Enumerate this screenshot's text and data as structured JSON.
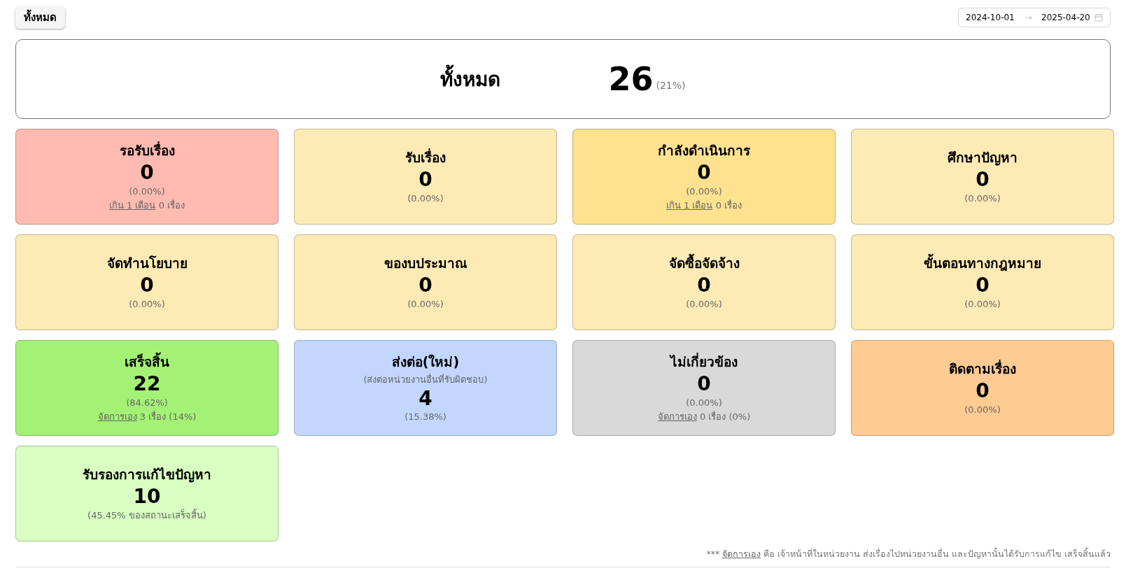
{
  "filter_button": {
    "label": "ทั้งหมด"
  },
  "date_range": {
    "start": "2024-10-01",
    "separator": "→",
    "end": "2025-04-20"
  },
  "summary": {
    "label": "ทั้งหมด",
    "count": "26",
    "percent": "(21%)"
  },
  "cards": [
    {
      "title": "รอรับเรื่อง",
      "count": "0",
      "percent": "(0.00%)",
      "color": "#ffbbb1",
      "note": {
        "link": "เกิน 1 เดือน",
        "text": "0 เรื่อง"
      }
    },
    {
      "title": "รับเรื่อง",
      "count": "0",
      "percent": "(0.00%)",
      "color": "#feeab5"
    },
    {
      "title": "กำลังดำเนินการ",
      "count": "0",
      "percent": "(0.00%)",
      "color": "#fee28f",
      "note": {
        "link": "เกิน 1 เดือน",
        "text": "0 เรื่อง"
      }
    },
    {
      "title": "ศึกษาปัญหา",
      "count": "0",
      "percent": "(0.00%)",
      "color": "#feeab5"
    },
    {
      "title": "จัดทำนโยบาย",
      "count": "0",
      "percent": "(0.00%)",
      "color": "#feeab5"
    },
    {
      "title": "ของบประมาณ",
      "count": "0",
      "percent": "(0.00%)",
      "color": "#feeab5"
    },
    {
      "title": "จัดซื้อจัดจ้าง",
      "count": "0",
      "percent": "(0.00%)",
      "color": "#feeab5"
    },
    {
      "title": "ขั้นตอนทางกฎหมาย",
      "count": "0",
      "percent": "(0.00%)",
      "color": "#feeab5"
    },
    {
      "title": "เสร็จสิ้น",
      "count": "22",
      "percent": "(84.62%)",
      "color": "#a3f275",
      "note": {
        "link": "จัดการเอง",
        "text": "3 เรื่อง (14%)"
      }
    },
    {
      "title": "ส่งต่อ(ใหม่)",
      "subtitle": "(ส่งต่อหน่วยงานอื่นที่รับผิดชอบ)",
      "count": "4",
      "percent": "(15.38%)",
      "color": "#c3d7fe"
    },
    {
      "title": "ไม่เกี่ยวข้อง",
      "count": "0",
      "percent": "(0.00%)",
      "color": "#d9d9d9",
      "note": {
        "link": "จัดการเอง",
        "text": "0 เรื่อง (0%)"
      }
    },
    {
      "title": "ติดตามเรื่อง",
      "count": "0",
      "percent": "(0.00%)",
      "color": "#fecb92"
    },
    {
      "title": "รับรองการแก้ไขปัญหา",
      "count": "10",
      "percent": "(45.45% ของสถานะเสร็จสิ้น)",
      "color": "#d8fec1"
    }
  ],
  "footnote": {
    "prefix": "***",
    "link": "จัดการเอง",
    "text": "คือ เจ้าหน้าที่ในหน่วยงาน ส่งเรื่องไปหน่วยงานอื่น และปัญหานั้นได้รับการแก้ไข เสร็จสิ้นแล้ว"
  }
}
